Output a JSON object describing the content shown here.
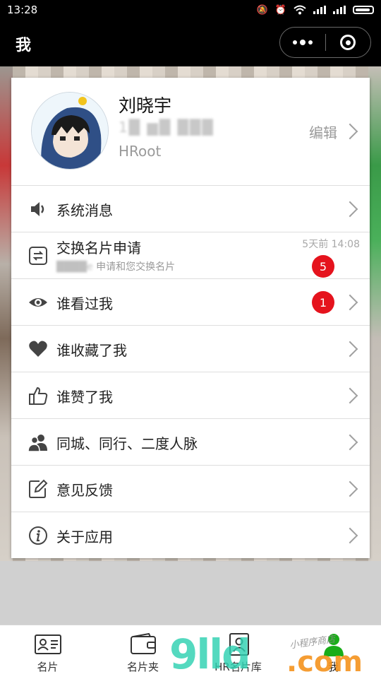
{
  "status": {
    "time": "13:28"
  },
  "navbar": {
    "title": "我"
  },
  "profile": {
    "name": "刘晓宇",
    "phone": "1█ ▆█ ███",
    "role": "HRoot",
    "edit_label": "编辑"
  },
  "menu": [
    {
      "label": "系统消息",
      "icon": "speaker-icon"
    },
    {
      "label": "交换名片申请",
      "icon": "exchange-icon",
      "sub_blur": "████e",
      "sub": " 申请和您交换名片",
      "time": "5天前 14:08",
      "badge": "5"
    },
    {
      "label": "谁看过我",
      "icon": "eye-icon",
      "badge": "1"
    },
    {
      "label": "谁收藏了我",
      "icon": "heart-icon"
    },
    {
      "label": "谁赞了我",
      "icon": "thumbs-up-icon"
    },
    {
      "label": "同城、同行、二度人脉",
      "icon": "contacts-icon"
    },
    {
      "label": "意见反馈",
      "icon": "edit-icon"
    },
    {
      "label": "关于应用",
      "icon": "info-icon"
    }
  ],
  "tabs": [
    {
      "label": "名片"
    },
    {
      "label": "名片夹"
    },
    {
      "label": "HR名片库"
    },
    {
      "label": "我"
    }
  ],
  "watermark": {
    "main": "9lld",
    "dot": ".com",
    "small": "小程序商店"
  },
  "colors": {
    "badge": "#e5131d",
    "active_tab": "#1aad19"
  }
}
